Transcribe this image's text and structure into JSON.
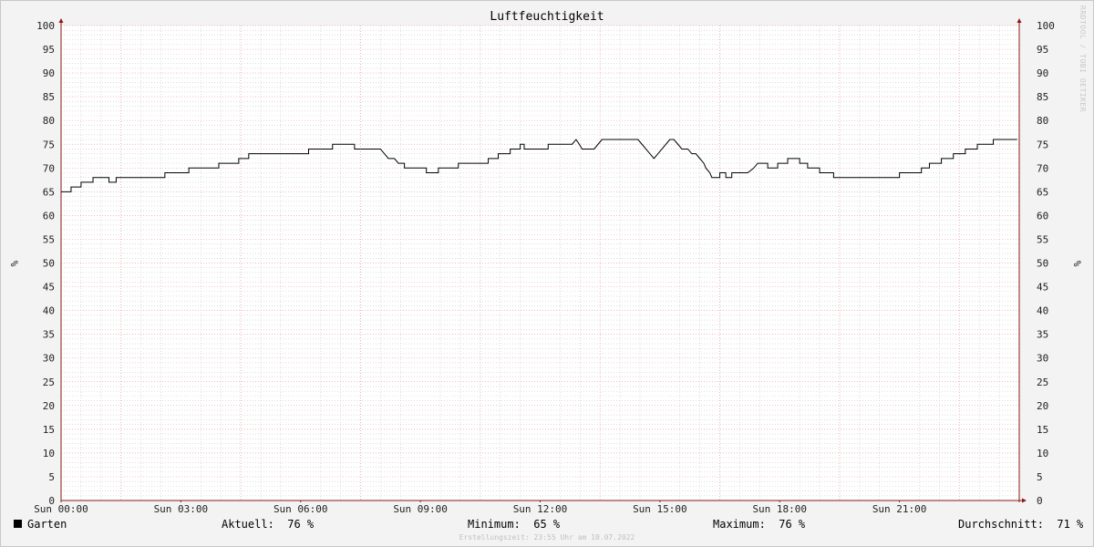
{
  "watermark": "RRDTOOL / TOBI OETIKER",
  "chart_data": {
    "type": "line",
    "title": "Luftfeuchtigkeit",
    "ylabel": "%",
    "ylim": [
      0,
      100
    ],
    "yticks": [
      "0",
      "5",
      "10",
      "15",
      "20",
      "25",
      "30",
      "35",
      "40",
      "45",
      "50",
      "55",
      "60",
      "65",
      "70",
      "75",
      "80",
      "85",
      "90",
      "95",
      "100"
    ],
    "xlim": [
      0,
      24
    ],
    "xticks": [
      {
        "x": 0,
        "label": "Sun 00:00"
      },
      {
        "x": 3,
        "label": "Sun 03:00"
      },
      {
        "x": 6,
        "label": "Sun 06:00"
      },
      {
        "x": 9,
        "label": "Sun 09:00"
      },
      {
        "x": 12,
        "label": "Sun 12:00"
      },
      {
        "x": 15,
        "label": "Sun 15:00"
      },
      {
        "x": 18,
        "label": "Sun 18:00"
      },
      {
        "x": 21,
        "label": "Sun 21:00"
      }
    ],
    "grid": true,
    "series": [
      {
        "name": "Garten",
        "color": "#000000",
        "points": [
          [
            0.0,
            65
          ],
          [
            0.25,
            65
          ],
          [
            0.25,
            66
          ],
          [
            0.5,
            66
          ],
          [
            0.5,
            67
          ],
          [
            0.8,
            67
          ],
          [
            0.8,
            68
          ],
          [
            1.2,
            68
          ],
          [
            1.2,
            67
          ],
          [
            1.38,
            67
          ],
          [
            1.38,
            68
          ],
          [
            2.6,
            68
          ],
          [
            2.6,
            69
          ],
          [
            3.2,
            69
          ],
          [
            3.2,
            70
          ],
          [
            3.95,
            70
          ],
          [
            3.95,
            71
          ],
          [
            4.45,
            71
          ],
          [
            4.45,
            72
          ],
          [
            4.7,
            72
          ],
          [
            4.7,
            73
          ],
          [
            6.0,
            73
          ],
          [
            6.2,
            73
          ],
          [
            6.2,
            74
          ],
          [
            6.8,
            74
          ],
          [
            6.8,
            75
          ],
          [
            7.35,
            75
          ],
          [
            7.35,
            74
          ],
          [
            8.0,
            74
          ],
          [
            8.1,
            73
          ],
          [
            8.2,
            72
          ],
          [
            8.35,
            72
          ],
          [
            8.45,
            71
          ],
          [
            8.6,
            71
          ],
          [
            8.6,
            70
          ],
          [
            9.15,
            70
          ],
          [
            9.15,
            69
          ],
          [
            9.45,
            69
          ],
          [
            9.45,
            70
          ],
          [
            9.95,
            70
          ],
          [
            9.95,
            71
          ],
          [
            10.7,
            71
          ],
          [
            10.7,
            72
          ],
          [
            10.95,
            72
          ],
          [
            10.95,
            73
          ],
          [
            11.25,
            73
          ],
          [
            11.25,
            74
          ],
          [
            11.5,
            74
          ],
          [
            11.5,
            75
          ],
          [
            11.6,
            75
          ],
          [
            11.6,
            74
          ],
          [
            12.2,
            74
          ],
          [
            12.2,
            75
          ],
          [
            12.8,
            75
          ],
          [
            12.9,
            76
          ],
          [
            12.98,
            75
          ],
          [
            13.05,
            74
          ],
          [
            13.35,
            74
          ],
          [
            13.45,
            75
          ],
          [
            13.55,
            76
          ],
          [
            14.45,
            76
          ],
          [
            14.55,
            75
          ],
          [
            14.65,
            74
          ],
          [
            14.75,
            73
          ],
          [
            14.85,
            72
          ],
          [
            14.95,
            73
          ],
          [
            15.05,
            74
          ],
          [
            15.15,
            75
          ],
          [
            15.25,
            76
          ],
          [
            15.35,
            76
          ],
          [
            15.45,
            75
          ],
          [
            15.55,
            74
          ],
          [
            15.7,
            74
          ],
          [
            15.8,
            73
          ],
          [
            15.9,
            73
          ],
          [
            16.0,
            72
          ],
          [
            16.1,
            71
          ],
          [
            16.15,
            70
          ],
          [
            16.25,
            69
          ],
          [
            16.3,
            68
          ],
          [
            16.5,
            68
          ],
          [
            16.5,
            69
          ],
          [
            16.65,
            69
          ],
          [
            16.65,
            68
          ],
          [
            16.8,
            68
          ],
          [
            16.8,
            69
          ],
          [
            17.2,
            69
          ],
          [
            17.35,
            70
          ],
          [
            17.45,
            71
          ],
          [
            17.7,
            71
          ],
          [
            17.7,
            70
          ],
          [
            17.95,
            70
          ],
          [
            17.95,
            71
          ],
          [
            18.2,
            71
          ],
          [
            18.2,
            72
          ],
          [
            18.5,
            72
          ],
          [
            18.5,
            71
          ],
          [
            18.7,
            71
          ],
          [
            18.7,
            70
          ],
          [
            19.0,
            70
          ],
          [
            19.0,
            69
          ],
          [
            19.35,
            69
          ],
          [
            19.35,
            68
          ],
          [
            21.0,
            68
          ],
          [
            21.0,
            69
          ],
          [
            21.55,
            69
          ],
          [
            21.55,
            70
          ],
          [
            21.75,
            70
          ],
          [
            21.75,
            71
          ],
          [
            22.05,
            71
          ],
          [
            22.05,
            72
          ],
          [
            22.35,
            72
          ],
          [
            22.35,
            73
          ],
          [
            22.65,
            73
          ],
          [
            22.65,
            74
          ],
          [
            22.95,
            74
          ],
          [
            22.95,
            75
          ],
          [
            23.35,
            75
          ],
          [
            23.35,
            76
          ],
          [
            23.95,
            76
          ]
        ]
      }
    ]
  },
  "legend": {
    "series_name": "Garten",
    "current_label": "Aktuell:",
    "current_value": "76 %",
    "min_label": "Minimum:",
    "min_value": "65 %",
    "max_label": "Maximum:",
    "max_value": "76 %",
    "avg_label": "Durchschnitt:",
    "avg_value": "71 %"
  },
  "footer": "Erstellungszeit: 23:55 Uhr am 10.07.2022",
  "colors": {
    "background": "#f3f3f3",
    "plot_background": "#ffffff",
    "grid_major": "#e8a0a0",
    "grid_minor": "#c8c8c8",
    "axis": "#8b1a1a",
    "line": "#000000"
  }
}
